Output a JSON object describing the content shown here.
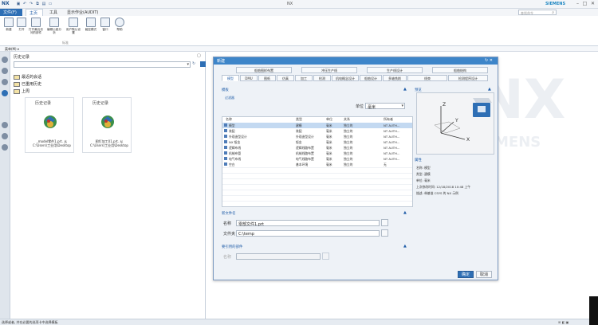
{
  "titlebar": {
    "logo": "NX",
    "window_title": "NX",
    "brand": "SIEMENS",
    "qa_icons": [
      "save-icon",
      "undo-icon",
      "redo-icon",
      "copy-icon",
      "paste-icon",
      "window-icon"
    ],
    "controls": [
      "–",
      "□",
      "✕"
    ]
  },
  "menubar": {
    "file": "文件(F)",
    "home": "主页",
    "tools": "工具",
    "extra": "显示作业(AUDIT)",
    "search_placeholder": "查找命令"
  },
  "ribbon": {
    "buttons": [
      "新建",
      "打开",
      "打开最近访问的部件",
      "编辑公差分析",
      "用户默认设置",
      "触控模式",
      "窗口",
      "帮助"
    ],
    "group_label": "标准"
  },
  "resbar": {
    "label": "菜单(M) ▾"
  },
  "history": {
    "title": "历史记录",
    "folders": [
      "最近的会话",
      "已重用历史",
      "上周"
    ],
    "cards": [
      {
        "date": "历史记录",
        "name": "_model零件1.prt. 从 C:\\Users\\工业用\\Desktop"
      },
      {
        "date": "历史记录",
        "name": "图钉加工01.prt. 从 C:\\Users\\工业用\\Desktop"
      }
    ]
  },
  "canvas": {
    "watermark": "NX",
    "brand_watermark": "MENS"
  },
  "status": {
    "text": "选择或者, 并在必要的选项卡中选择模板"
  },
  "dialog": {
    "title": "新建",
    "tabs_row1": [
      "船舶图样布置",
      "冲压生产线",
      "生产线设计",
      "船舶结构"
    ],
    "tabs_row2": [
      "模型",
      "DMU",
      "图纸",
      "仿真",
      "加工",
      "检测",
      "机电概念设计",
      "船舶设计",
      "多轴铣削",
      "线束",
      "检测程序设计"
    ],
    "templates": {
      "header": "模板",
      "filter_label": "过滤器",
      "unit_label": "单位",
      "unit_value": "毫米",
      "columns": [
        "名称",
        "类型",
        "单位",
        "关系",
        "所有者"
      ],
      "rows": [
        [
          "模型",
          "建模",
          "毫米",
          "独立的",
          "NT AUTH..."
        ],
        [
          "装配",
          "装配",
          "毫米",
          "独立的",
          "NT AUTH..."
        ],
        [
          "外观造型设计",
          "外观造型设计",
          "毫米",
          "独立的",
          "NT AUTH..."
        ],
        [
          "NX 钣金",
          "钣金",
          "毫米",
          "独立的",
          "NT AUTH..."
        ],
        [
          "逻辑布线",
          "逻辑线路布置",
          "毫米",
          "独立的",
          "NT AUTH..."
        ],
        [
          "机械布管",
          "机械线路布置",
          "毫米",
          "独立的",
          "NT AUTH..."
        ],
        [
          "电气布线",
          "电气线路布置",
          "毫米",
          "独立的",
          "NT AUTH..."
        ],
        [
          "空白",
          "基本环境",
          "毫米",
          "独立的",
          "无"
        ]
      ]
    },
    "preview": {
      "header": "预览",
      "props_header": "属性",
      "props": [
        "名称: 模型",
        "类型: 建模",
        "单位: 毫米",
        "上次修改时间: 12/18/2018 10:48 上午",
        "描述: 带基准 CSYS 的 NX 示例"
      ]
    },
    "newfile": {
      "header": "新文件名",
      "name_label": "名称",
      "name_value": "零部文件1.prt",
      "folder_label": "文件夹",
      "folder_value": "C:\\temp"
    },
    "ref": {
      "header": "要引用的部件",
      "name_label": "名称"
    },
    "ok": "确定",
    "cancel": "取消"
  }
}
